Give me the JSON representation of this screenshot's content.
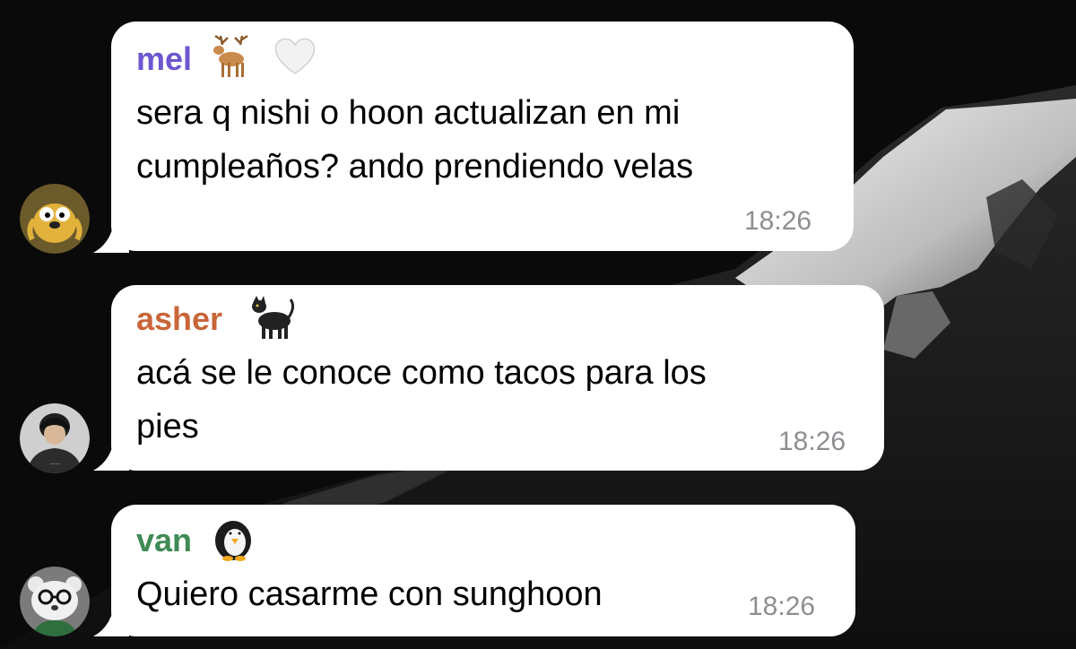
{
  "messages": [
    {
      "sender": "mel",
      "sender_color": "#6e56cf",
      "sender_emojis": [
        "deer-icon",
        "white-heart-icon"
      ],
      "lines": [
        "sera q nishi o hoon actualizan en mi",
        "cumpleaños? ando prendiendo velas"
      ],
      "time": "18:26",
      "avatar": "jake-dog-avatar"
    },
    {
      "sender": "asher",
      "sender_color": "#c8663a",
      "sender_emojis": [
        "black-cat-icon"
      ],
      "lines": [
        "acá se le conoce como tacos para los",
        "pies"
      ],
      "time": "18:26",
      "avatar": "person-avatar"
    },
    {
      "sender": "van",
      "sender_color": "#3f8a55",
      "sender_emojis": [
        "penguin-icon"
      ],
      "lines": [
        "Quiero casarme con sunghoon"
      ],
      "time": "18:26",
      "avatar": "bear-glasses-avatar"
    }
  ]
}
